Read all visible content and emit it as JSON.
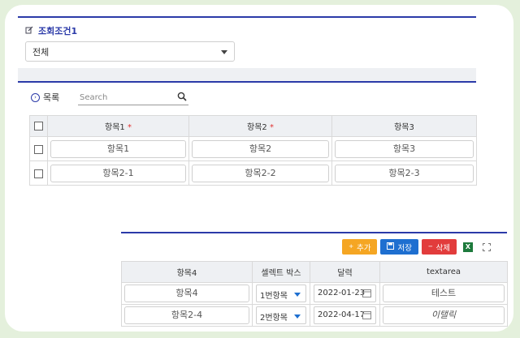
{
  "condition": {
    "title": "조회조건1",
    "select_value": "전체"
  },
  "list": {
    "title": "목록",
    "search_placeholder": "Search",
    "columns": [
      "항목1",
      "항목2",
      "항목3"
    ],
    "rows": [
      [
        "항목1",
        "항목2",
        "항목3"
      ],
      [
        "항목2-1",
        "항목2-2",
        "항목2-3"
      ]
    ]
  },
  "editor": {
    "buttons": {
      "add": "추가",
      "save": "저장",
      "delete": "삭제"
    },
    "excel_icon": "excel-icon",
    "columns": [
      "항목4",
      "셀렉트 박스",
      "달력",
      "textarea"
    ],
    "rows": [
      {
        "item": "항목4",
        "select": "1번항목",
        "date": "2022-01-23",
        "text": "테스트"
      },
      {
        "item": "항목2-4",
        "select": "2번항목",
        "date": "2022-04-17",
        "text": "이탤릭"
      }
    ]
  },
  "colors": {
    "accent": "#2b3aa8",
    "add": "#f5a623",
    "save": "#1e6fd0",
    "delete": "#e23c3c",
    "background": "#e4f0dc"
  }
}
